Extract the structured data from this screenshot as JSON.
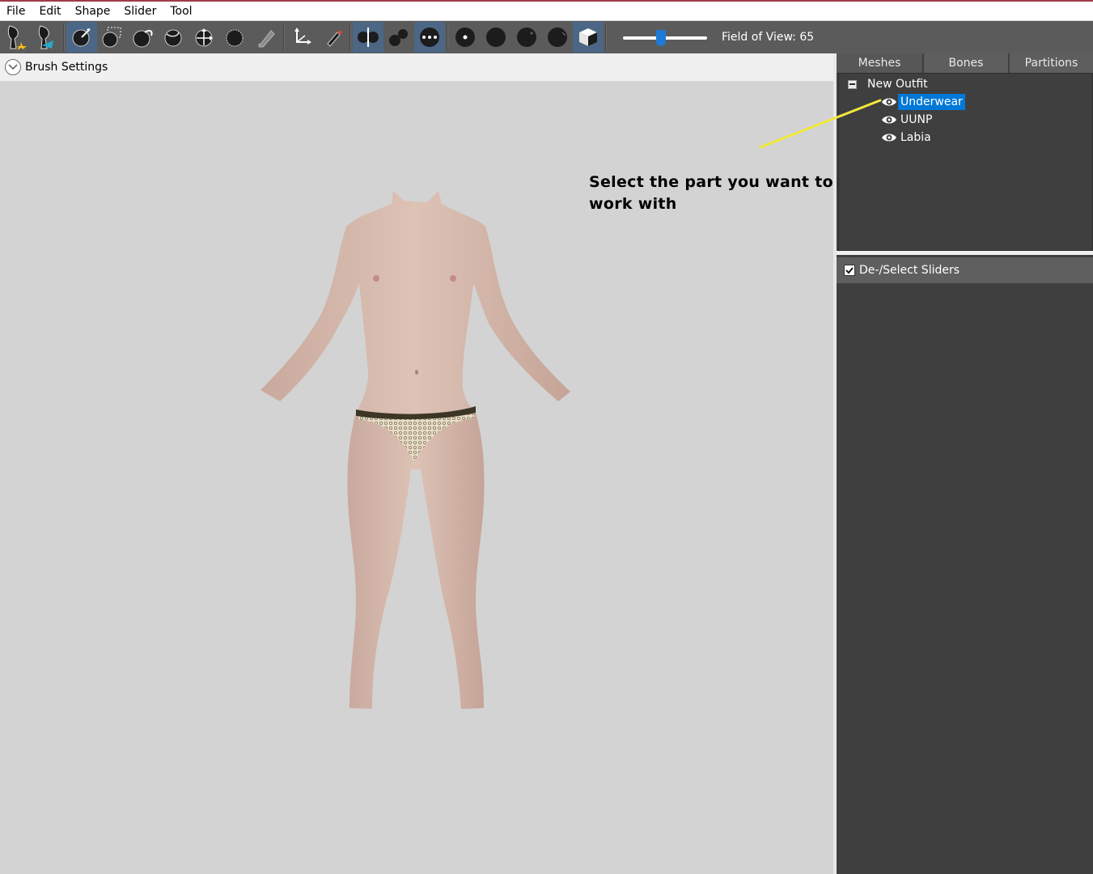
{
  "menu": {
    "items": [
      "File",
      "Edit",
      "Shape",
      "Slider",
      "Tool"
    ]
  },
  "toolbar": {
    "fov_label": "Field of View: 65",
    "fov_value": 65,
    "fov_slider_fraction": 0.45,
    "accent_color": "#4b6785",
    "slider_color": "#1e7ad6"
  },
  "brush_settings": {
    "label": "Brush Settings"
  },
  "annotation": {
    "text": "Select the part you want to work with",
    "pointer_color": "#f2e93a"
  },
  "right_panel": {
    "tabs": [
      {
        "label": "Meshes",
        "active": true
      },
      {
        "label": "Bones",
        "active": false
      },
      {
        "label": "Partitions",
        "active": false
      }
    ],
    "tree": {
      "root_label": "New Outfit",
      "children": [
        {
          "label": "Underwear",
          "selected": true,
          "icon": "eye-icon"
        },
        {
          "label": "UUNP",
          "selected": false,
          "icon": "eye-icon"
        },
        {
          "label": "Labia",
          "selected": false,
          "icon": "eye-icon"
        }
      ]
    },
    "sliders_header": {
      "label": "De-/Select Sliders",
      "checked": true
    }
  },
  "selection_color": "#0078d7"
}
